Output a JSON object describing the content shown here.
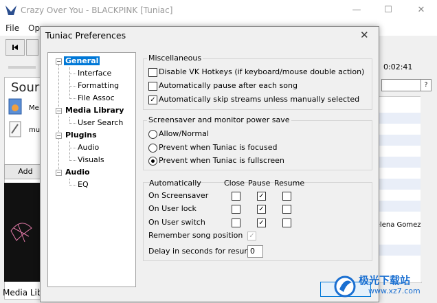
{
  "main_window": {
    "title": "Crazy Over You - BLACKPINK [Tuniac]",
    "menu": [
      "File",
      "Op"
    ],
    "time": "0:02:41",
    "sources_heading": "Sour",
    "sources_items": [
      "Me",
      "mus"
    ],
    "add_label": "Add",
    "status_label": "Media Lib",
    "right_artist": "lelena Gomez",
    "minimize": "—",
    "maximize": "☐",
    "close": "✕"
  },
  "dialog": {
    "title": "Tuniac Preferences",
    "close": "✕",
    "ok_label": "OK",
    "tree": {
      "general": "General",
      "interface": "Interface",
      "formatting": "Formatting",
      "file_assoc": "File Assoc",
      "media_library": "Media Library",
      "user_search": "User Search",
      "plugins": "Plugins",
      "audio_plugin": "Audio",
      "visuals": "Visuals",
      "audio": "Audio",
      "eq": "EQ"
    },
    "misc": {
      "title": "Miscellaneous",
      "disable_vk": "Disable VK Hotkeys (if keyboard/mouse double action)",
      "auto_pause": "Automatically pause after each song",
      "auto_skip": "Automatically skip streams unless manually selected"
    },
    "power": {
      "title": "Screensaver and monitor power save",
      "allow": "Allow/Normal",
      "prevent_focused": "Prevent when Tuniac is focused",
      "prevent_fullscreen": "Prevent when Tuniac is fullscreen"
    },
    "auto": {
      "title": "Automatically",
      "col_close": "Close",
      "col_pause": "Pause",
      "col_resume": "Resume",
      "row_screensaver": "On Screensaver",
      "row_userlock": "On User lock",
      "row_userswitch": "On User switch",
      "remember": "Remember song position",
      "delay_label": "Delay in seconds for resume",
      "delay_value": "0"
    },
    "check": "✓"
  },
  "watermark": {
    "text_cn": "极光下载站",
    "text_url": "www.xz7.com"
  },
  "colors": {
    "selection": "#0078d7",
    "watermark_blue": "#1a6fd1"
  }
}
